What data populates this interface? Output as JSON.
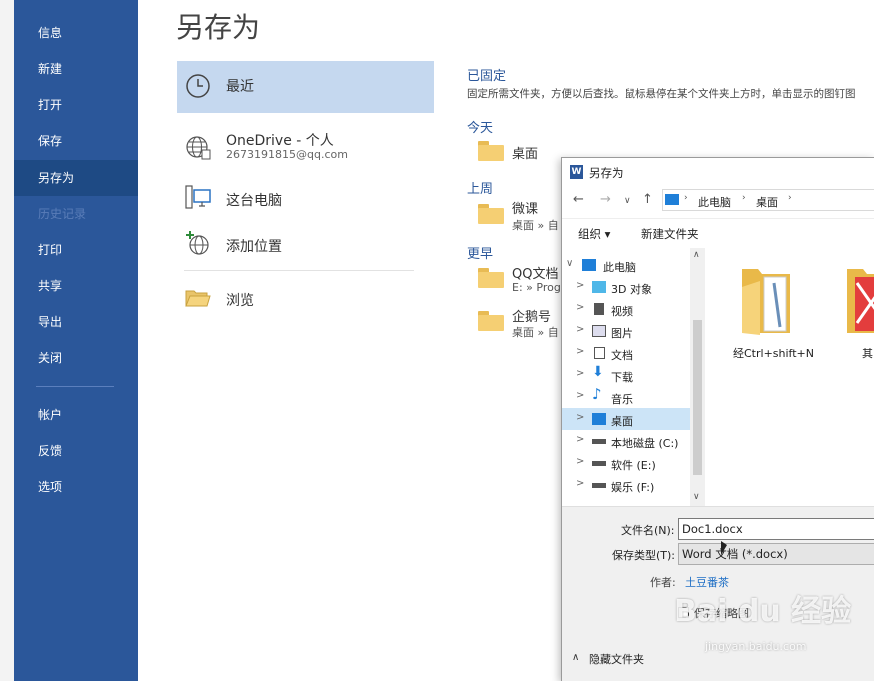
{
  "sidebar": {
    "items": [
      {
        "label": "信息"
      },
      {
        "label": "新建"
      },
      {
        "label": "打开"
      },
      {
        "label": "保存"
      },
      {
        "label": "另存为"
      },
      {
        "label": "历史记录"
      },
      {
        "label": "打印"
      },
      {
        "label": "共享"
      },
      {
        "label": "导出"
      },
      {
        "label": "关闭"
      },
      {
        "label": "帐户"
      },
      {
        "label": "反馈"
      },
      {
        "label": "选项"
      }
    ]
  },
  "backstage": {
    "title": "另存为",
    "locations": [
      {
        "label": "最近",
        "icon": "clock-icon"
      },
      {
        "label": "OneDrive - 个人",
        "sub": "2673191815@qq.com",
        "icon": "globe-icon"
      },
      {
        "label": "这台电脑",
        "icon": "computer-icon"
      },
      {
        "label": "添加位置",
        "icon": "add-globe-icon"
      },
      {
        "label": "浏览",
        "icon": "open-folder-icon"
      }
    ],
    "pinned_heading": "已固定",
    "pinned_desc": "固定所需文件夹，方便以后查找。鼠标悬停在某个文件夹上方时，单击显示的图钉图",
    "today_heading": "今天",
    "lastweek_heading": "上周",
    "earlier_heading": "更早",
    "folders": {
      "today": {
        "name": "桌面"
      },
      "lastweek": {
        "name": "微课",
        "path": "桌面 » 自"
      },
      "earlier1": {
        "name": "QQ文档",
        "path": "E: » Prog"
      },
      "earlier2": {
        "name": "企鹅号",
        "path": "桌面 » 自"
      }
    }
  },
  "dialog": {
    "title": "另存为",
    "app_letter": "W",
    "breadcrumb": [
      "此电脑",
      "桌面"
    ],
    "toolbar": {
      "organize": "组织 ▾",
      "new_folder": "新建文件夹"
    },
    "tree": [
      {
        "label": "此电脑",
        "arrow": "∨",
        "icon": "pc-icon"
      },
      {
        "label": "3D 对象",
        "arrow": ">",
        "icon": "cube-icon"
      },
      {
        "label": "视频",
        "arrow": ">",
        "icon": "video-icon"
      },
      {
        "label": "图片",
        "arrow": ">",
        "icon": "picture-icon"
      },
      {
        "label": "文档",
        "arrow": ">",
        "icon": "document-icon"
      },
      {
        "label": "下载",
        "arrow": ">",
        "icon": "download-icon"
      },
      {
        "label": "音乐",
        "arrow": ">",
        "icon": "music-icon"
      },
      {
        "label": "桌面",
        "arrow": ">",
        "icon": "desktop-icon"
      },
      {
        "label": "本地磁盘 (C:)",
        "arrow": ">",
        "icon": "drive-c-icon"
      },
      {
        "label": "软件 (E:)",
        "arrow": ">",
        "icon": "drive-icon"
      },
      {
        "label": "娱乐 (F:)",
        "arrow": ">",
        "icon": "drive-icon"
      }
    ],
    "content_items": [
      {
        "label": "经Ctrl+shift+N"
      },
      {
        "label": "其"
      }
    ],
    "filename_label": "文件名(N):",
    "filename_value": "Doc1.docx",
    "filetype_label": "保存类型(T):",
    "filetype_value": "Word 文档 (*.docx)",
    "author_label": "作者:",
    "author_value": "土豆番茶",
    "thumbnail_label": "保存缩略图",
    "hide_folders": "隐藏文件夹"
  },
  "watermark": {
    "text": "Bai du 经验",
    "url": "jingyan.baidu.com"
  }
}
